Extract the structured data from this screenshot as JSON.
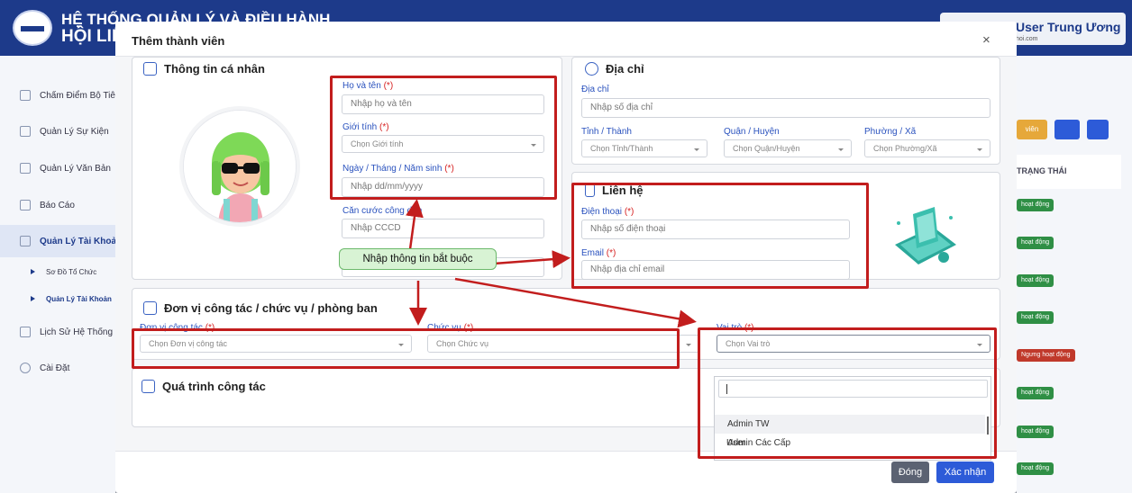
{
  "app": {
    "title_line1": "HỆ THỐNG QUẢN LÝ VÀ ĐIỀU HÀNH",
    "title_line2": "HỘI LIÊN HIỆP",
    "user_name": "User Trung Ương",
    "user_email": "hoi.com"
  },
  "sidebar": {
    "items": [
      {
        "label": "Chấm Điểm Bộ Tiêu Chí"
      },
      {
        "label": "Quản Lý Sự Kiện"
      },
      {
        "label": "Quản Lý Văn Bản"
      },
      {
        "label": "Báo Cáo"
      },
      {
        "label": "Quản Lý Tài Khoản"
      },
      {
        "label": "Lịch Sử Hệ Thống"
      },
      {
        "label": "Cài Đặt"
      }
    ],
    "subitems": [
      {
        "label": "Sơ Đồ Tổ Chức"
      },
      {
        "label": "Quản Lý Tài Khoản"
      }
    ]
  },
  "right_panel": {
    "btn_add": "viên",
    "column_header": "TRẠNG THÁI",
    "badges": [
      "hoạt động",
      "hoạt động",
      "hoạt động",
      "hoạt động",
      "Ngưng hoạt động",
      "hoạt động",
      "hoạt động",
      "hoạt động"
    ]
  },
  "modal": {
    "title": "Thêm thành viên",
    "close": "×",
    "personal": {
      "title": "Thông tin cá nhân",
      "fullname_label": "Họ và tên",
      "fullname_placeholder": "Nhập họ và tên",
      "gender_label": "Giới tính",
      "gender_placeholder": "Chọn Giới tính",
      "dob_label": "Ngày / Tháng / Năm sinh",
      "dob_placeholder": "Nhập dd/mm/yyyy",
      "cccd_label": "Căn cước công dân",
      "cccd_placeholder": "Nhập CCCD",
      "req": "(*)"
    },
    "address": {
      "title": "Địa chỉ",
      "address_label": "Địa chỉ",
      "address_placeholder": "Nhập số địa chỉ",
      "province_label": "Tỉnh / Thành",
      "province_placeholder": "Chọn Tỉnh/Thành",
      "district_label": "Quận / Huyện",
      "district_placeholder": "Chọn Quận/Huyện",
      "ward_label": "Phường / Xã",
      "ward_placeholder": "Chọn Phường/Xã"
    },
    "contact": {
      "title": "Liên hệ",
      "phone_label": "Điện thoại",
      "phone_placeholder": "Nhập số điện thoại",
      "email_label": "Email",
      "email_placeholder": "Nhập địa chỉ email"
    },
    "work": {
      "title": "Đơn vị công tác / chức vụ / phòng ban",
      "unit_label": "Đơn vị công tác",
      "unit_placeholder": "Chọn Đơn vị công tác",
      "position_label": "Chức vụ",
      "position_placeholder": "Chọn Chức vụ",
      "role_label": "Vai trò",
      "role_placeholder": "Chọn Vai trò"
    },
    "role_options": [
      "Admin TW",
      "Admin Các Cấp",
      "User"
    ],
    "history": {
      "title": "Quá trình công tác"
    },
    "callout": "Nhập thông tin bắt buộc",
    "btn_close": "Đóng",
    "btn_confirm": "Xác nhận"
  },
  "colors": {
    "primary": "#1d3a8a",
    "label": "#2a52be",
    "required": "#d62020",
    "annotation": "#c21d1d",
    "confirm": "#2d5bd8",
    "close_btn": "#5b6272"
  }
}
